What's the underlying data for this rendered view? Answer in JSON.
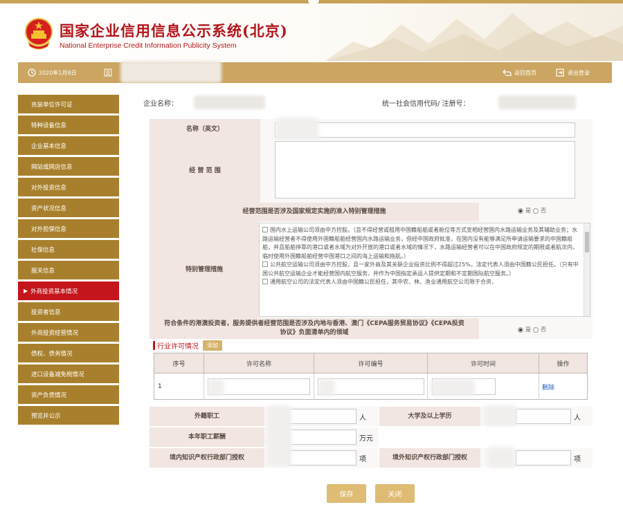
{
  "header": {
    "title": "国家企业信用信息公示系统(北京)",
    "subtitle": "National Enterprise Credit Information Publicity System"
  },
  "topbar": {
    "date": "2020年1月8日",
    "home_label": "返回首页",
    "logout_label": "退出登录"
  },
  "sidebar": {
    "items": [
      {
        "label": "充装单位许可证"
      },
      {
        "label": "特种设备信息"
      },
      {
        "label": "企业基本信息"
      },
      {
        "label": "网站或网店信息"
      },
      {
        "label": "对外投资信息"
      },
      {
        "label": "资产状况信息"
      },
      {
        "label": "对外担保信息"
      },
      {
        "label": "社保信息"
      },
      {
        "label": "报关信息"
      },
      {
        "label": "外商投资基本情况",
        "active": true
      },
      {
        "label": "投资者信息"
      },
      {
        "label": "外商投资经营情况"
      },
      {
        "label": "债权、债务情况"
      },
      {
        "label": "进口设备减免税情况"
      },
      {
        "label": "资产负债情况"
      },
      {
        "label": "预览并公示"
      }
    ]
  },
  "main": {
    "company_name_label": "企业名称：",
    "credit_code_label": "统一社会信用代码/ 注册号：",
    "name_en_label": "名称（英文）",
    "scope_label": "经 营 范 围",
    "special_q_label": "经营范围是否涉及国家规定实施的准入特别管理措施",
    "special_measure_label": "特别管理措施",
    "yes": "是",
    "no": "否",
    "measures_text": [
      "国内水上运输公司须由中方控股。（且不得经营或租用中国籍船舶或者舱位等方式变相经营国内水路运输业务及其辅助业务；水路运输经营者不得使用外国籍船舶经营国内水路运输业务，但经中国政府批准，在国内没有能够满足所申请运输要求的中国籍船舶，并且船舶停靠的港口或者水域为对外开放的港口或者水域的情况下，水路运输经营者可以在中国政府规定的期限或者航次内，临时使用外国籍船舶经营中国港口之间的海上运输和拖航。）",
      "公共航空运输公司须由中方控股，且一家外商及其关联企业投资比例不得超过25%，法定代表人须由中国籍公民担任。（只有中国公共航空运输企业才能经营国内航空服务，并作为中国指定承运人提供定期和不定期国际航空服务。）",
      "通用航空公司的法定代表人须由中国籍公民担任，其中农、林、渔业通用航空公司限于合资，"
    ],
    "cepa_label": "符合条件的港澳投资者，服务提供者经营范围是否涉及内地与香港、澳门《CEPA服务贸易协议》《CEPA投资协议》负面清单内的领域"
  },
  "license": {
    "section_title": "行业许可情况",
    "add_label": "添加",
    "columns": [
      "序号",
      "许可名称",
      "许可编号",
      "许可时间",
      "操作"
    ],
    "rows": [
      {
        "index": "1",
        "action": "删除"
      }
    ]
  },
  "stats": {
    "foreign_staff_label": "外籍职工",
    "college_label": "大学及以上学历",
    "salary_label": "本年职工薪酬",
    "domestic_ip_label": "境内知识产权行政部门授权",
    "foreign_ip_label": "境外知识产权行政部门授权",
    "unit_person": "人",
    "unit_money": "万元",
    "unit_item": "项"
  },
  "buttons": {
    "save": "保存",
    "close": "关闭"
  },
  "colors": {
    "brand_red": "#c3151b",
    "gold": "#cba561",
    "sidebar_gold": "#a8802d",
    "label_bg": "#f1e6e1"
  },
  "icons": {
    "clock": "clock-icon",
    "user": "user-icon",
    "home": "home-back-icon",
    "logout": "logout-icon"
  }
}
